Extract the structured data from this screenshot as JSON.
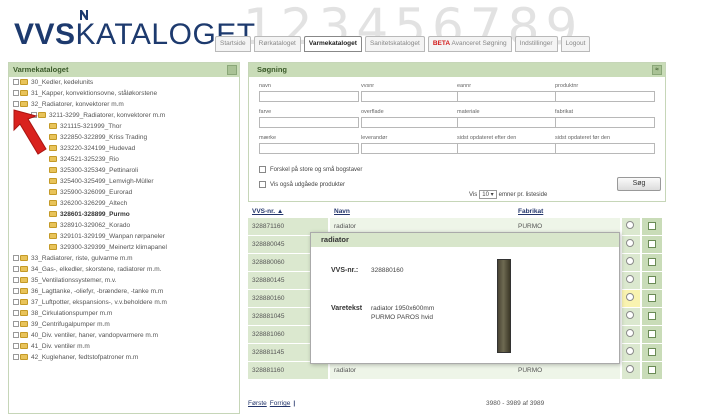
{
  "logo": {
    "part1": "VVS",
    "part2": "KATALOGET",
    "bg_digits": "123456789"
  },
  "tabs": [
    {
      "label": "Startside",
      "active": false
    },
    {
      "label": "Rørkataloget",
      "active": false
    },
    {
      "label": "Varmekataloget",
      "active": true
    },
    {
      "label": "Sanitetskataloget",
      "active": false
    },
    {
      "label": "Avanceret Søgning",
      "badge": "BETA",
      "active": false
    },
    {
      "label": "Indstillinger",
      "active": false
    },
    {
      "label": "Logout",
      "active": false
    }
  ],
  "sidebar": {
    "title": "Varmekataloget",
    "items": [
      {
        "label": "30_Kedler, kedelunits",
        "level": 0
      },
      {
        "label": "31_Kapper, konvektionsovne, ståløkorstene",
        "level": 0
      },
      {
        "label": "32_Radiatorer, konvektorer m.m",
        "level": 0
      },
      {
        "label": "3211-3299_Radiatorer, konvektorer m.m",
        "level": 1
      },
      {
        "label": "321115-321999_Thor",
        "level": 2
      },
      {
        "label": "322850-322899_Kriss Trading",
        "level": 2
      },
      {
        "label": "323220-324199_Hudevad",
        "level": 2
      },
      {
        "label": "324521-325239_Rio",
        "level": 2
      },
      {
        "label": "325300-325349_Pettinaroli",
        "level": 2
      },
      {
        "label": "325400-325499_Lemvigh-Müller",
        "level": 2
      },
      {
        "label": "325900-326099_Eurorad",
        "level": 2
      },
      {
        "label": "326200-326299_Altech",
        "level": 2
      },
      {
        "label": "328601-328899_Purmo",
        "level": 2,
        "bold": true
      },
      {
        "label": "328910-329062_Korado",
        "level": 2
      },
      {
        "label": "329101-329199_Wanpan rørpaneler",
        "level": 2
      },
      {
        "label": "329300-329399_Meinertz klimapanel",
        "level": 2
      },
      {
        "label": "33_Radiatorer, riste, gulvarme m.m",
        "level": 0
      },
      {
        "label": "34_Gas-, elkedler, skorstene, radiatorer m.m.",
        "level": 0
      },
      {
        "label": "35_Ventilationssystemer, m.v.",
        "level": 0
      },
      {
        "label": "36_Lagttanke, -oliefyr, -brændere, -tanke m.m",
        "level": 0
      },
      {
        "label": "37_Luftpotter, ekspansions-, v.v.beholdere m.m",
        "level": 0
      },
      {
        "label": "38_Cirkulationspumper m.m",
        "level": 0
      },
      {
        "label": "39_Centrifugalpumper m.m",
        "level": 0
      },
      {
        "label": "40_Div. ventiler, haner, vandopvarmere m.m",
        "level": 0
      },
      {
        "label": "41_Div. ventiler m.m",
        "level": 0
      },
      {
        "label": "42_Kuglehaner, fedtstofpatroner m.m",
        "level": 0
      }
    ]
  },
  "search": {
    "title": "Søgning",
    "fields": [
      {
        "label": "navn"
      },
      {
        "label": "vvsnr"
      },
      {
        "label": "eannr"
      },
      {
        "label": "produktnr"
      },
      {
        "label": "farve"
      },
      {
        "label": "overflade"
      },
      {
        "label": "materiale"
      },
      {
        "label": "fabrikat"
      },
      {
        "label": "mærke"
      },
      {
        "label": "leverandør"
      },
      {
        "label": "sidst opdateret efter den"
      },
      {
        "label": "sidst opdateret før den"
      }
    ],
    "case_sensitive": "Forskel på store og små bogstaver",
    "show_expired": "Vis også udgåede produkter",
    "show_label": "Vis",
    "per_page": "10",
    "per_page_suffix": "emner pr. listeside",
    "search_button": "Søg"
  },
  "results": {
    "columns": {
      "vvs": "VVS-nr. ▲",
      "name": "Navn",
      "brand": "Fabrikat"
    },
    "rows": [
      {
        "vvs": "328871160",
        "name": "radiator",
        "brand": "PURMO"
      },
      {
        "vvs": "328880045",
        "name": "",
        "brand": ""
      },
      {
        "vvs": "328880060",
        "name": "",
        "brand": ""
      },
      {
        "vvs": "328880145",
        "name": "",
        "brand": ""
      },
      {
        "vvs": "328880160",
        "name": "",
        "brand": ""
      },
      {
        "vvs": "328881045",
        "name": "",
        "brand": ""
      },
      {
        "vvs": "328881060",
        "name": "",
        "brand": ""
      },
      {
        "vvs": "328881145",
        "name": "",
        "brand": ""
      },
      {
        "vvs": "328881160",
        "name": "radiator",
        "brand": "PURMO"
      }
    ],
    "pager": {
      "first": "Første",
      "prev": "Forrige",
      "sep": "|"
    },
    "count": "3980 - 3989 af 3989"
  },
  "popup": {
    "title": "radiator",
    "vvs_label": "VVS-nr.:",
    "vvs_value": "328880160",
    "text_label": "Varetekst",
    "text_line1": "radiator 1950x600mm",
    "text_line2": "PURMO PAROS hvid"
  },
  "colors": {
    "accent_green": "#c9dcb8",
    "navy": "#1d3a6e",
    "beta_red": "#d21a1a"
  }
}
